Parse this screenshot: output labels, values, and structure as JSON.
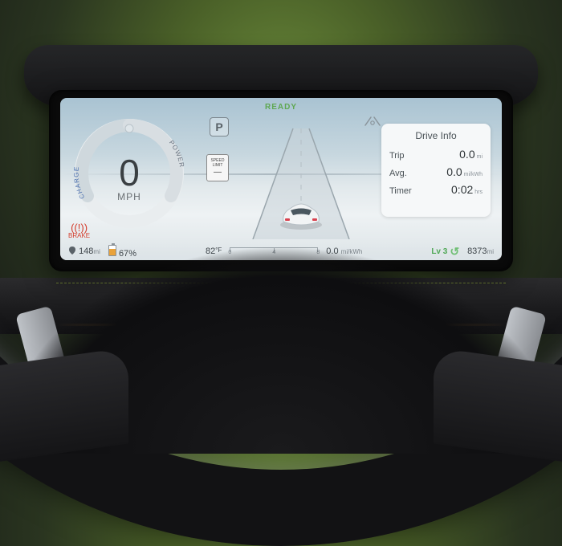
{
  "status": {
    "ready_label": "READY",
    "gear": "P",
    "speed_limit_label_1": "SPEED",
    "speed_limit_label_2": "LIMIT",
    "speed_limit_value": "—"
  },
  "speed": {
    "value": "0",
    "unit": "MPH",
    "charge_label": "CHARGE",
    "power_label": "POWER"
  },
  "drive_info": {
    "title": "Drive Info",
    "trip_label": "Trip",
    "trip_value": "0.0",
    "trip_unit": "mi",
    "avg_label": "Avg.",
    "avg_value": "0.0",
    "avg_unit": "mi/kWh",
    "timer_label": "Timer",
    "timer_value": "0:02",
    "timer_unit": "hrs"
  },
  "warnings": {
    "brake_label": "BRAKE"
  },
  "bottom": {
    "range_value": "148",
    "range_unit": "mi",
    "battery_pct": "67",
    "battery_pct_suffix": "%",
    "temp_value": "82",
    "temp_unit": "°F",
    "ruler_0": "0",
    "ruler_mid": "4",
    "ruler_end": "8",
    "efficiency_value": "0.0",
    "efficiency_unit": "mi/kWh",
    "regen_label": "Lv 3",
    "odometer_value": "8373",
    "odometer_unit": "mi"
  },
  "colors": {
    "accent_green": "#5fa852",
    "warn_red": "#d43b2a",
    "ring_blue": "#6f8fb8"
  }
}
